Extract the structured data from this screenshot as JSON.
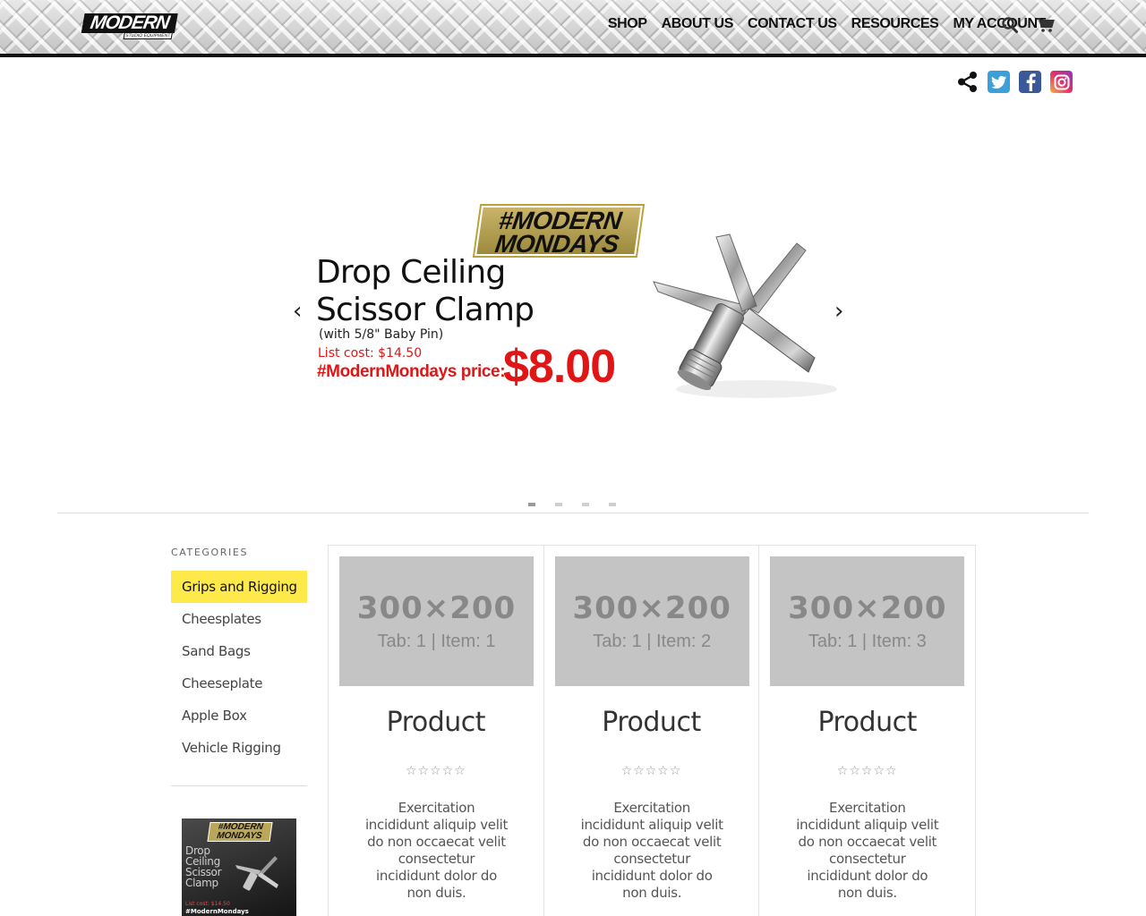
{
  "header": {
    "logo_text": "MODERN",
    "logo_sub": "STUDIO EQUIPMENT",
    "nav": [
      "SHOP",
      "ABOUT US",
      "CONTACT US",
      "RESOURCES",
      "MY ACCOUNT"
    ],
    "icons": [
      "search-icon",
      "cart-icon"
    ]
  },
  "social": [
    "share-icon",
    "twitter-icon",
    "facebook-icon",
    "instagram-icon"
  ],
  "slider": {
    "badge_line1": "#MODERN",
    "badge_line2": "MONDAYS",
    "title_line1": "Drop Ceiling",
    "title_line2": "Scissor Clamp",
    "subtitle": "(with 5/8\" Baby Pin)",
    "list_cost": "List cost: $14.50",
    "promo_label": "#ModernMondays price:",
    "price": "$8.00",
    "prev": "‹",
    "next": "›",
    "slide_count": 4,
    "active_slide": 1
  },
  "sidebar": {
    "heading": "CATEGORIES",
    "items": [
      "Grips and Rigging",
      "Cheesplates",
      "Sand Bags",
      "Cheeseplate",
      "Apple Box",
      "Vehicle Rigging"
    ],
    "active_index": 0,
    "promo": {
      "badge": "#MODERN MONDAYS",
      "title": "Drop Ceiling Scissor Clamp",
      "list_cost": "List cost: $14.50",
      "tag": "#ModernMondays"
    }
  },
  "products": [
    {
      "placeholder_size": "300×200",
      "placeholder_label": "Tab: 1 | Item: 1",
      "title": "Product",
      "stars": "☆☆☆☆☆",
      "description": "Exercitation incididunt aliquip velit do non occaecat velit consectetur incididunt dolor do non duis."
    },
    {
      "placeholder_size": "300×200",
      "placeholder_label": "Tab: 1 | Item: 2",
      "title": "Product",
      "stars": "☆☆☆☆☆",
      "description": "Exercitation incididunt aliquip velit do non occaecat velit consectetur incididunt dolor do non duis."
    },
    {
      "placeholder_size": "300×200",
      "placeholder_label": "Tab: 1 | Item: 3",
      "title": "Product",
      "stars": "☆☆☆☆☆",
      "description": "Exercitation incididunt aliquip velit do non occaecat velit consectetur incididunt dolor do non duis."
    }
  ],
  "colors": {
    "accent_yellow": "#fde94a",
    "price_red": "#e01515",
    "placeholder_gray": "#c4c4c4"
  }
}
